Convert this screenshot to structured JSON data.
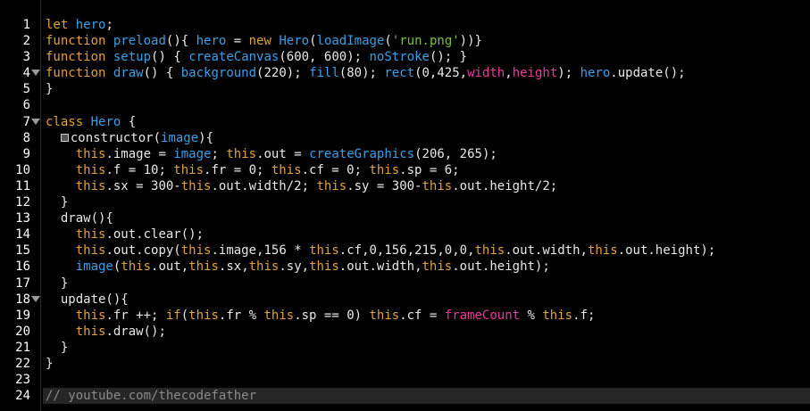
{
  "editor": {
    "lines": [
      {
        "n": "1",
        "t": "let hero;"
      },
      {
        "n": "2",
        "t": "function preload(){ hero = new Hero(loadImage('run.png'))}"
      },
      {
        "n": "3",
        "t": "function setup() { createCanvas(600, 600); noStroke(); }"
      },
      {
        "n": "4",
        "t": "function draw() { background(220); fill(80); rect(0,425,width,height); hero.update();"
      },
      {
        "n": "5",
        "t": "}"
      },
      {
        "n": "6",
        "t": ""
      },
      {
        "n": "7",
        "t": "class Hero {"
      },
      {
        "n": "8",
        "t": "  constructor(image){"
      },
      {
        "n": "9",
        "t": "    this.image = image; this.out = createGraphics(206, 265);"
      },
      {
        "n": "10",
        "t": "    this.f = 10; this.fr = 0; this.cf = 0; this.sp = 6;"
      },
      {
        "n": "11",
        "t": "    this.sx = 300-this.out.width/2; this.sy = 300-this.out.height/2;"
      },
      {
        "n": "12",
        "t": "  }"
      },
      {
        "n": "13",
        "t": "  draw(){"
      },
      {
        "n": "14",
        "t": "    this.out.clear();"
      },
      {
        "n": "15",
        "t": "    this.out.copy(this.image,156 * this.cf,0,156,215,0,0,this.out.width,this.out.height);"
      },
      {
        "n": "16",
        "t": "    image(this.out,this.sx,this.sy,this.out.width,this.out.height);"
      },
      {
        "n": "17",
        "t": "  }"
      },
      {
        "n": "18",
        "t": "  update(){"
      },
      {
        "n": "19",
        "t": "    this.fr ++; if(this.fr % this.sp == 0) this.cf = frameCount % this.f;"
      },
      {
        "n": "20",
        "t": "    this.draw();"
      },
      {
        "n": "21",
        "t": "  }"
      },
      {
        "n": "22",
        "t": "}"
      },
      {
        "n": "23",
        "t": ""
      },
      {
        "n": "24",
        "t": "// youtube.com/thecodefather"
      }
    ],
    "colors": {
      "background": "#000000",
      "keyword": "#e0a23a",
      "function": "#3aa0e8",
      "string": "#7dc13a",
      "special": "#e83a9a",
      "comment": "#8a8a8a",
      "active_line": "#262626"
    }
  }
}
